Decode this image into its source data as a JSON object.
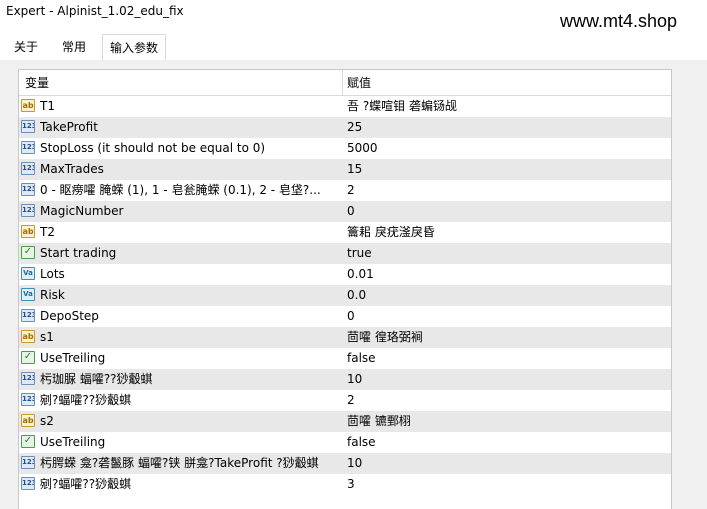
{
  "window": {
    "title": "Expert - Alpinist_1.02_edu_fix"
  },
  "watermark": "www.mt4.shop",
  "tabs": [
    {
      "label": "关于",
      "active": false
    },
    {
      "label": "常用",
      "active": false
    },
    {
      "label": "输入参数",
      "active": true
    }
  ],
  "grid": {
    "col_variable": "变量",
    "col_value": "赋值",
    "rows": [
      {
        "type": "ab",
        "name": "T1",
        "value": "吾  ?蝶喧钼   砻蝙铴觇"
      },
      {
        "type": "123",
        "name": "TakeProfit",
        "value": "25"
      },
      {
        "type": "123",
        "name": "StopLoss (it should not be equal to 0)",
        "value": "5000"
      },
      {
        "type": "123",
        "name": "MaxTrades",
        "value": "15"
      },
      {
        "type": "123",
        "name": "0 - 眍痨嚯      腌蝾 (1), 1 - 皂瓮腌蝾 (0.1), 2 - 皂垡?...",
        "value": "2"
      },
      {
        "type": "123",
        "name": "MagicNumber",
        "value": "0"
      },
      {
        "type": "ab",
        "name": "T2",
        "value": "籥耜 戾疣滏戾昏"
      },
      {
        "type": "bool",
        "name": "Start trading",
        "value": "true"
      },
      {
        "type": "dbl",
        "name": "Lots",
        "value": "0.01"
      },
      {
        "type": "dbl",
        "name": "Risk",
        "value": "0.0"
      },
      {
        "type": "123",
        "name": "DepoStep",
        "value": "0"
      },
      {
        "type": "ab",
        "name": "s1",
        "value": "茴嚯 徨珞弼裥"
      },
      {
        "type": "bool",
        "name": "UseTreiling",
        "value": "false"
      },
      {
        "type": "123",
        "name": "杇珈脲 蝠嚯??猀觳蜞",
        "value": "10"
      },
      {
        "type": "123",
        "name": "剜?蝠嚯??猀觳蜞",
        "value": "2"
      },
      {
        "type": "ab",
        "name": "s2",
        "value": "茴嚯 镳鄄栩"
      },
      {
        "type": "bool",
        "name": "UseTreiling",
        "value": "false"
      },
      {
        "type": "123",
        "name": "杇腭蝾   龛?砻鬣豚 蝠嚯?铗 胼龛?TakeProfit ?猀觳蜞",
        "value": "10"
      },
      {
        "type": "123",
        "name": "剜?蝠嚯??猀觳蜞",
        "value": "3"
      }
    ]
  },
  "icon_names": {
    "ab": "string-param-icon",
    "123": "integer-param-icon",
    "bool": "boolean-param-icon",
    "dbl": "double-param-icon"
  }
}
